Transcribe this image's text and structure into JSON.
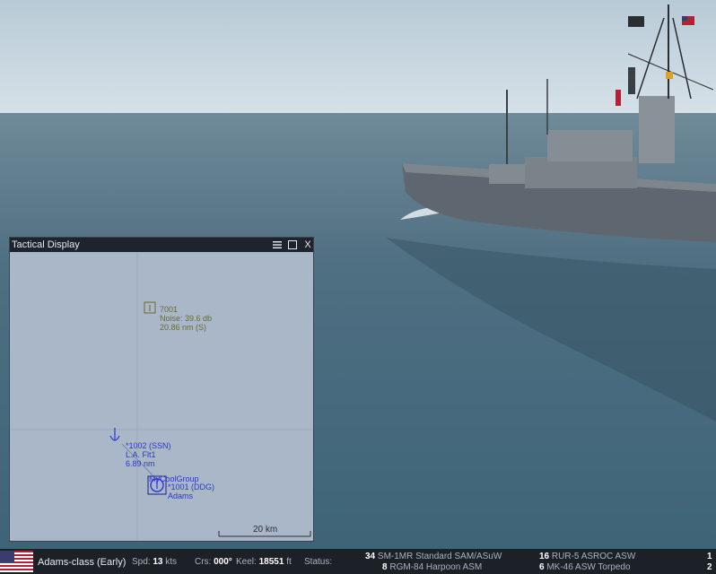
{
  "tactical_display": {
    "title": "Tactical Display",
    "menu_icon": "hamburger-icon",
    "maximize_icon": "maximize-icon",
    "close_label": "X",
    "contacts": [
      {
        "id_line": "7001",
        "line2": "Noise: 39.6 db",
        "line3": "20.86 nm (S)",
        "color": "#6b6a2e"
      },
      {
        "id_line": "*1002 (SSN)",
        "line2": "L.A. Flt1",
        "line3": "6.89 nm",
        "color": "#2a36d8"
      },
      {
        "id_line": "*1001 (DDG)",
        "line2": "Adams",
        "line3": "",
        "color": "#2a36d8"
      }
    ],
    "group_label": "MyCoolGroup",
    "scale_label": "20 km"
  },
  "status_bar": {
    "unit_class": "Adams-class (Early)",
    "speed_label": "Spd:",
    "speed_value": "13",
    "speed_unit": "kts",
    "course_label": "Crs:",
    "course_value": "000°",
    "keel_label": "Keel:",
    "keel_value": "18551",
    "keel_unit": "ft",
    "status_label": "Status:",
    "weapons": [
      {
        "count": "34",
        "name": "SM-1MR Standard SAM/ASuW"
      },
      {
        "count": "8",
        "name": "RGM-84 Harpoon ASM"
      },
      {
        "count": "16",
        "name": "RUR-5 ASROC ASW"
      },
      {
        "count": "6",
        "name": "MK-46 ASW Torpedo"
      },
      {
        "count": "1",
        "name": ""
      },
      {
        "count": "2",
        "name": ""
      }
    ]
  },
  "colors": {
    "hostile": "#6b6a2e",
    "friendly": "#2a36d8",
    "sea": "#4f6f82",
    "sky": "#bccfdc"
  }
}
